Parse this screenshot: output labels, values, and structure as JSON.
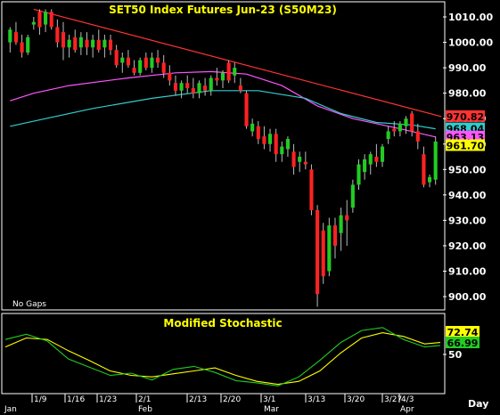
{
  "chart_data": [
    {
      "type": "candlestick",
      "title": "SET50  Index  Futures  Jun-23  (S50M23)",
      "annotation": "No  Gaps",
      "ylim": [
        895,
        1020
      ],
      "y_ticks": [
        "1010.00",
        "1000.00",
        "990.00",
        "980.00",
        "970.00",
        "960.00",
        "950.00",
        "940.00",
        "930.00",
        "920.00",
        "910.00",
        "900.00"
      ],
      "y_tick_values": [
        1010,
        1000,
        990,
        980,
        970,
        960,
        950,
        940,
        930,
        920,
        910,
        900
      ],
      "price_tags": [
        {
          "label": "970.82",
          "value": 970.82,
          "bg": "#ff3333",
          "fg": "#000000"
        },
        {
          "label": "968.04",
          "value": 966.0,
          "bg": "#33cccc",
          "fg": "#000000"
        },
        {
          "label": "963.13",
          "value": 962.8,
          "bg": "#ff55ff",
          "fg": "#000000"
        },
        {
          "label": "961.70",
          "value": 959.4,
          "bg": "#ffff00",
          "fg": "#000000"
        }
      ],
      "candles": [
        {
          "o": 1000,
          "h": 1006,
          "l": 996,
          "c": 1005
        },
        {
          "o": 1004,
          "h": 1008,
          "l": 999,
          "c": 1000
        },
        {
          "o": 1000,
          "h": 1003,
          "l": 994,
          "c": 996
        },
        {
          "o": 996,
          "h": 1003,
          "l": 995,
          "c": 1002
        },
        {
          "o": 1007,
          "h": 1010,
          "l": 1005,
          "c": 1008
        },
        {
          "o": 1012,
          "h": 1013,
          "l": 1003,
          "c": 1006
        },
        {
          "o": 1007,
          "h": 1013,
          "l": 1004,
          "c": 1012
        },
        {
          "o": 1012,
          "h": 1013,
          "l": 1005,
          "c": 1006
        },
        {
          "o": 1006,
          "h": 1009,
          "l": 998,
          "c": 1000
        },
        {
          "o": 1004,
          "h": 1008,
          "l": 993,
          "c": 998
        },
        {
          "o": 998,
          "h": 1003,
          "l": 994,
          "c": 1001
        },
        {
          "o": 1002,
          "h": 1005,
          "l": 996,
          "c": 997
        },
        {
          "o": 998,
          "h": 1004,
          "l": 995,
          "c": 1002
        },
        {
          "o": 1001,
          "h": 1004,
          "l": 995,
          "c": 998
        },
        {
          "o": 998,
          "h": 1003,
          "l": 994,
          "c": 1001
        },
        {
          "o": 1001,
          "h": 1005,
          "l": 996,
          "c": 997
        },
        {
          "o": 998,
          "h": 1003,
          "l": 994,
          "c": 1001
        },
        {
          "o": 1001,
          "h": 1003,
          "l": 995,
          "c": 997
        },
        {
          "o": 997,
          "h": 999,
          "l": 990,
          "c": 991
        },
        {
          "o": 992,
          "h": 996,
          "l": 988,
          "c": 994
        },
        {
          "o": 994,
          "h": 997,
          "l": 990,
          "c": 991
        },
        {
          "o": 990,
          "h": 993,
          "l": 987,
          "c": 988
        },
        {
          "o": 988,
          "h": 994,
          "l": 987,
          "c": 993
        },
        {
          "o": 994,
          "h": 996,
          "l": 989,
          "c": 990
        },
        {
          "o": 990,
          "h": 996,
          "l": 988,
          "c": 994
        },
        {
          "o": 994,
          "h": 997,
          "l": 990,
          "c": 992
        },
        {
          "o": 992,
          "h": 995,
          "l": 986,
          "c": 988
        },
        {
          "o": 988,
          "h": 991,
          "l": 983,
          "c": 985
        },
        {
          "o": 984,
          "h": 987,
          "l": 979,
          "c": 981
        },
        {
          "o": 981,
          "h": 985,
          "l": 978,
          "c": 984
        },
        {
          "o": 984,
          "h": 987,
          "l": 980,
          "c": 982
        },
        {
          "o": 982,
          "h": 986,
          "l": 978,
          "c": 980
        },
        {
          "o": 980,
          "h": 985,
          "l": 978,
          "c": 984
        },
        {
          "o": 983,
          "h": 986,
          "l": 979,
          "c": 981
        },
        {
          "o": 981,
          "h": 987,
          "l": 979,
          "c": 986
        },
        {
          "o": 986,
          "h": 990,
          "l": 983,
          "c": 985
        },
        {
          "o": 985,
          "h": 989,
          "l": 982,
          "c": 988
        },
        {
          "o": 992,
          "h": 993,
          "l": 984,
          "c": 985
        },
        {
          "o": 987,
          "h": 992,
          "l": 984,
          "c": 990
        },
        {
          "o": 983,
          "h": 986,
          "l": 980,
          "c": 981
        },
        {
          "o": 980,
          "h": 981,
          "l": 966,
          "c": 967
        },
        {
          "o": 965,
          "h": 970,
          "l": 963,
          "c": 968
        },
        {
          "o": 967,
          "h": 969,
          "l": 960,
          "c": 962
        },
        {
          "o": 963,
          "h": 967,
          "l": 958,
          "c": 960
        },
        {
          "o": 960,
          "h": 966,
          "l": 957,
          "c": 964
        },
        {
          "o": 964,
          "h": 966,
          "l": 953,
          "c": 956
        },
        {
          "o": 956,
          "h": 961,
          "l": 953,
          "c": 959
        },
        {
          "o": 958,
          "h": 963,
          "l": 955,
          "c": 962
        },
        {
          "o": 957,
          "h": 960,
          "l": 948,
          "c": 951
        },
        {
          "o": 953,
          "h": 957,
          "l": 949,
          "c": 955
        },
        {
          "o": 953,
          "h": 957,
          "l": 950,
          "c": 952
        },
        {
          "o": 950,
          "h": 952,
          "l": 932,
          "c": 934
        },
        {
          "o": 934,
          "h": 936,
          "l": 896,
          "c": 901
        },
        {
          "o": 926,
          "h": 929,
          "l": 905,
          "c": 908
        },
        {
          "o": 910,
          "h": 931,
          "l": 908,
          "c": 928
        },
        {
          "o": 928,
          "h": 931,
          "l": 915,
          "c": 920
        },
        {
          "o": 925,
          "h": 935,
          "l": 918,
          "c": 932
        },
        {
          "o": 932,
          "h": 938,
          "l": 920,
          "c": 930
        },
        {
          "o": 935,
          "h": 946,
          "l": 933,
          "c": 944
        },
        {
          "o": 944,
          "h": 954,
          "l": 942,
          "c": 952
        },
        {
          "o": 949,
          "h": 956,
          "l": 946,
          "c": 954
        },
        {
          "o": 952,
          "h": 957,
          "l": 948,
          "c": 956
        },
        {
          "o": 955,
          "h": 960,
          "l": 951,
          "c": 953
        },
        {
          "o": 953,
          "h": 960,
          "l": 951,
          "c": 959
        },
        {
          "o": 962,
          "h": 967,
          "l": 960,
          "c": 965
        },
        {
          "o": 966,
          "h": 969,
          "l": 963,
          "c": 965
        },
        {
          "o": 965,
          "h": 969,
          "l": 963,
          "c": 968
        },
        {
          "o": 967,
          "h": 971,
          "l": 964,
          "c": 970
        },
        {
          "o": 972,
          "h": 973,
          "l": 963,
          "c": 965
        },
        {
          "o": 965,
          "h": 968,
          "l": 958,
          "c": 961
        },
        {
          "o": 956,
          "h": 959,
          "l": 943,
          "c": 944
        },
        {
          "o": 945,
          "h": 948,
          "l": 943,
          "c": 947
        },
        {
          "o": 946,
          "h": 963,
          "l": 944,
          "c": 961
        }
      ],
      "series": [
        {
          "name": "",
          "color": "#ff55ff",
          "values": [
            [
              0,
              977
            ],
            [
              4,
              980
            ],
            [
              10,
              983
            ],
            [
              20,
              986
            ],
            [
              28,
              988
            ],
            [
              34,
              988.5
            ],
            [
              40,
              987.5
            ],
            [
              46,
              983
            ],
            [
              52,
              975
            ],
            [
              58,
              970
            ],
            [
              66,
              966
            ],
            [
              72,
              962.8
            ]
          ]
        },
        {
          "name": "",
          "color": "#33cccc",
          "values": [
            [
              0,
              967
            ],
            [
              6,
              970
            ],
            [
              14,
              974
            ],
            [
              24,
              978
            ],
            [
              34,
              981
            ],
            [
              42,
              981
            ],
            [
              50,
              978
            ],
            [
              56,
              972
            ],
            [
              62,
              968.5
            ],
            [
              68,
              967.5
            ],
            [
              72,
              966
            ]
          ]
        },
        {
          "name": "",
          "color": "#ff3333",
          "values": [
            [
              4,
              1013
            ],
            [
              73,
              970.82
            ]
          ]
        }
      ],
      "dates": [
        "1/9",
        "1/16",
        "1/23",
        "2/1",
        "2/13",
        "2/20",
        "3/1",
        "3/13",
        "3/20",
        "3/27",
        "4/3"
      ],
      "months": [
        "Jan",
        "Feb",
        "Mar",
        "Apr"
      ],
      "period": "Day",
      "colors": {
        "up": "#22cc22",
        "down": "#ff2222",
        "wick": "#bbbbbb"
      }
    },
    {
      "type": "line",
      "title": "Modified  Stochastic",
      "ylim": [
        0,
        100
      ],
      "y_ticks": [
        "50"
      ],
      "y_tick_values": [
        50
      ],
      "value_tags": [
        {
          "label": "72.74",
          "value": 72.74,
          "bg": "#ffff00",
          "fg": "#000000"
        },
        {
          "label": "66.99",
          "value": 66.99,
          "bg": "#22cc22",
          "fg": "#000000"
        }
      ],
      "series": [
        {
          "name": "",
          "color": "#ffff00",
          "values": [
            [
              0,
              60
            ],
            [
              4,
              72
            ],
            [
              8,
              70
            ],
            [
              12,
              55
            ],
            [
              16,
              42
            ],
            [
              20,
              28
            ],
            [
              24,
              22
            ],
            [
              28,
              20
            ],
            [
              32,
              24
            ],
            [
              36,
              28
            ],
            [
              40,
              32
            ],
            [
              44,
              22
            ],
            [
              48,
              14
            ],
            [
              52,
              10
            ],
            [
              56,
              14
            ],
            [
              60,
              28
            ],
            [
              64,
              52
            ],
            [
              68,
              72
            ],
            [
              72,
              79
            ],
            [
              76,
              74
            ],
            [
              80,
              64
            ],
            [
              83,
              66
            ]
          ]
        },
        {
          "name": "",
          "color": "#22cc22",
          "values": [
            [
              0,
              70
            ],
            [
              4,
              77
            ],
            [
              8,
              68
            ],
            [
              12,
              44
            ],
            [
              16,
              33
            ],
            [
              20,
              22
            ],
            [
              24,
              25
            ],
            [
              28,
              16
            ],
            [
              32,
              30
            ],
            [
              36,
              34
            ],
            [
              40,
              26
            ],
            [
              44,
              15
            ],
            [
              48,
              12
            ],
            [
              52,
              8
            ],
            [
              56,
              20
            ],
            [
              60,
              42
            ],
            [
              64,
              66
            ],
            [
              68,
              82
            ],
            [
              72,
              86
            ],
            [
              76,
              70
            ],
            [
              80,
              60
            ],
            [
              83,
              62
            ]
          ]
        }
      ]
    }
  ]
}
